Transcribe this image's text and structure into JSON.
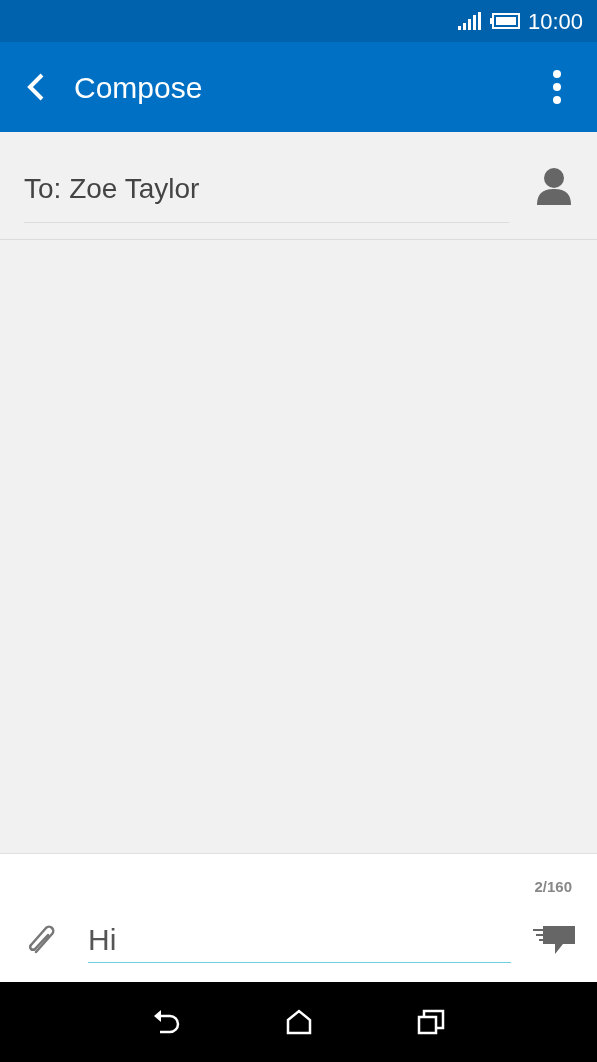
{
  "status_bar": {
    "time": "10:00"
  },
  "app_bar": {
    "title": "Compose"
  },
  "recipient": {
    "value": "To: Zoe Taylor"
  },
  "composer": {
    "counter": "2/160",
    "message": "Hi"
  }
}
